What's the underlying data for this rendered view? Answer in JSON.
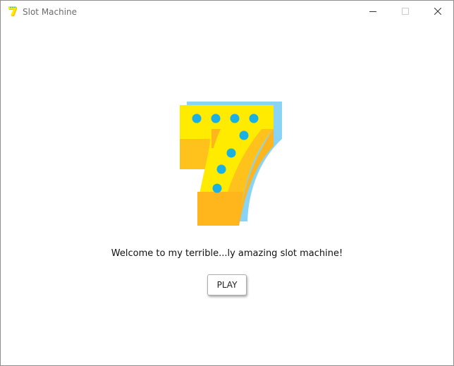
{
  "window": {
    "title": "Slot Machine",
    "controls": [
      "minimize",
      "maximize",
      "close"
    ]
  },
  "main": {
    "logo_icon": "lucky-seven-icon",
    "welcome_text": "Welcome to my terrible...ly amazing slot machine!",
    "play_label": "PLAY"
  },
  "colors": {
    "seven_yellow": "#ffeb00",
    "seven_orange": "#ffb51c",
    "seven_shadow": "#89d4f5",
    "seven_dots": "#1ab0e6"
  }
}
